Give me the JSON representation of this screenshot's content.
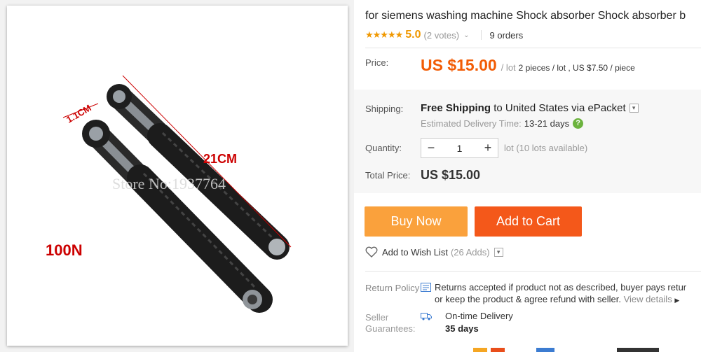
{
  "product": {
    "title": "for siemens washing machine Shock absorber Shock absorber b",
    "rating_value": "5.0",
    "votes": "(2 votes)",
    "orders": "9 orders",
    "colors": {
      "accent_orange": "#f25c05",
      "star": "#f09800",
      "buy_now": "#faa13c",
      "add_to_cart": "#f4581a"
    }
  },
  "image": {
    "watermark": "Store No:1937764",
    "dim_diameter": "1.1CM",
    "dim_length": "21CM",
    "force_label": "100N"
  },
  "price": {
    "label": "Price:",
    "value": "US $15.00",
    "unit": "/ lot",
    "pieces": "2 pieces / lot , US $7.50 / piece"
  },
  "shipping": {
    "label": "Shipping:",
    "free": "Free Shipping",
    "to": "to",
    "destination": "United States",
    "via": "via",
    "method": "ePacket",
    "eta_label": "Estimated Delivery Time:",
    "eta_days": "13-21 days"
  },
  "quantity": {
    "label": "Quantity:",
    "value": "1",
    "minus": "−",
    "plus": "+",
    "note": "lot (10 lots available)"
  },
  "total": {
    "label": "Total Price:",
    "value": "US $15.00"
  },
  "actions": {
    "buy_now": "Buy Now",
    "add_to_cart": "Add to Cart",
    "wish_list": "Add to Wish List",
    "wish_count": "(26 Adds)"
  },
  "policy": {
    "return_label": "Return Policy",
    "return_line1": "Returns accepted if product not as described, buyer pays retur",
    "return_line2": "or keep the product & agree refund with seller.",
    "view_details": "View details",
    "seller_label_1": "Seller",
    "seller_label_2": "Guarantees:",
    "ontime": "On-time Delivery",
    "ontime_days": "35 days"
  }
}
